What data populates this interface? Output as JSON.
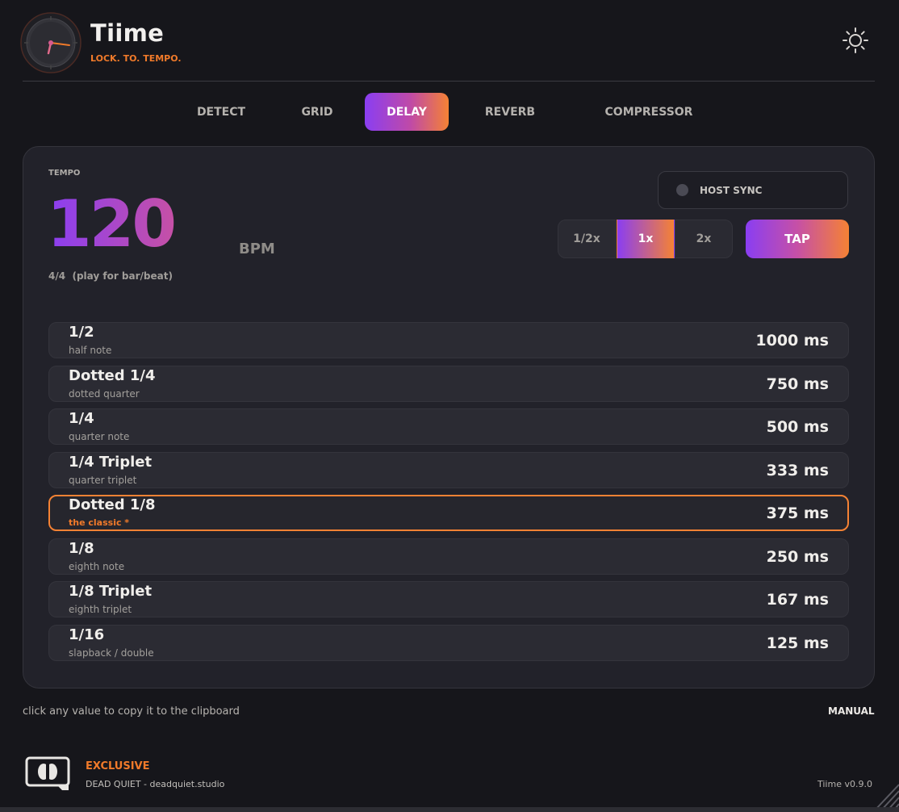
{
  "app": {
    "title": "Tiime",
    "tagline": "LOCK. TO. TEMPO."
  },
  "header": {
    "theme_icon": "sun-icon"
  },
  "tabs": [
    {
      "label": "DETECT",
      "active": false
    },
    {
      "label": "GRID",
      "active": false
    },
    {
      "label": "DELAY",
      "active": true
    },
    {
      "label": "REVERB",
      "active": false
    },
    {
      "label": "COMPRESSOR",
      "active": false
    }
  ],
  "tempo": {
    "label": "TEMPO",
    "value": "120",
    "unit": "BPM",
    "signature": "4/4",
    "signature_hint": "(play for bar/beat)"
  },
  "host_sync": {
    "label": "HOST SYNC",
    "enabled": false
  },
  "multipliers": [
    {
      "label": "1/2x",
      "active": false
    },
    {
      "label": "1x",
      "active": true
    },
    {
      "label": "2x",
      "active": false
    }
  ],
  "tap": {
    "label": "TAP"
  },
  "delay_rows": [
    {
      "name": "1/2",
      "sub": "half note",
      "value": "1000 ms",
      "highlight": false
    },
    {
      "name": "Dotted 1/4",
      "sub": "dotted quarter",
      "value": "750 ms",
      "highlight": false
    },
    {
      "name": "1/4",
      "sub": "quarter note",
      "value": "500 ms",
      "highlight": false
    },
    {
      "name": "1/4 Triplet",
      "sub": "quarter triplet",
      "value": "333 ms",
      "highlight": false
    },
    {
      "name": "Dotted 1/8",
      "sub": "the classic  *",
      "value": "375 ms",
      "highlight": true
    },
    {
      "name": "1/8",
      "sub": "eighth note",
      "value": "250 ms",
      "highlight": false
    },
    {
      "name": "1/8 Triplet",
      "sub": "eighth triplet",
      "value": "167 ms",
      "highlight": false
    },
    {
      "name": "1/16",
      "sub": "slapback / double",
      "value": "125 ms",
      "highlight": false
    }
  ],
  "footer_hint": "click any value to copy it to the clipboard",
  "manual_label": "MANUAL",
  "footer": {
    "exclusive": "EXCLUSIVE",
    "brand": "DEAD QUIET",
    "separator": " - ",
    "site": "deadquiet.studio",
    "version": "Tiime v0.9.0"
  },
  "colors": {
    "accent_orange": "#f58234",
    "accent_purple": "#8a3ef2",
    "panel_bg": "#22222a",
    "app_bg": "#16161b"
  }
}
